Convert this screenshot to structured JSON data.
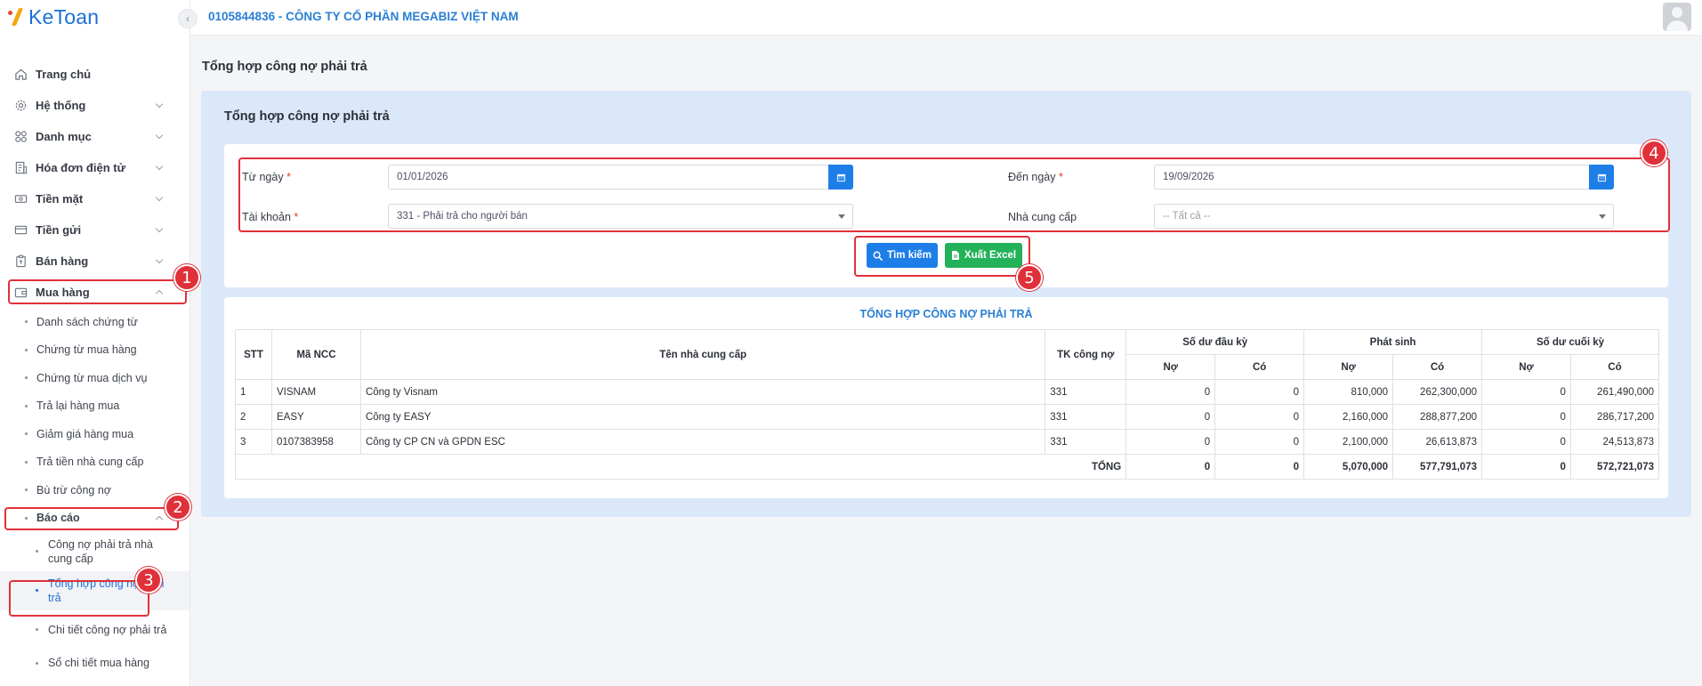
{
  "app": {
    "logo_text": "KeToan"
  },
  "topbar": {
    "company": "0105844836 - CÔNG TY CỔ PHẦN MEGABIZ VIỆT NAM"
  },
  "sidebar": {
    "items": [
      {
        "label": "Trang chủ",
        "icon": "home-icon"
      },
      {
        "label": "Hệ thống",
        "icon": "gear-icon"
      },
      {
        "label": "Danh mục",
        "icon": "grid-icon"
      },
      {
        "label": "Hóa đơn điện tử",
        "icon": "invoice-icon"
      },
      {
        "label": "Tiền mặt",
        "icon": "cash-icon"
      },
      {
        "label": "Tiền gửi",
        "icon": "card-icon"
      },
      {
        "label": "Bán hàng",
        "icon": "clipboard-icon"
      },
      {
        "label": "Mua hàng",
        "icon": "wallet-icon"
      }
    ],
    "purchase_sub": [
      "Danh sách chứng từ",
      "Chứng từ mua hàng",
      "Chứng từ mua dịch vụ",
      "Trả lại hàng mua",
      "Giảm giá hàng mua",
      "Trả tiền nhà cung cấp",
      "Bù trừ công nợ"
    ],
    "reports_label": "Báo cáo",
    "reports_sub": [
      "Công nợ phải trả nhà cung cấp",
      "Tổng hợp công nợ phải trả",
      "Chi tiết công nợ phải trả",
      "Sổ chi tiết mua hàng"
    ]
  },
  "page": {
    "title": "Tổng hợp công nợ phải trả",
    "panel_title": "Tổng hợp công nợ phải trả"
  },
  "filters": {
    "from_label": "Từ ngày",
    "from_value": "01/01/2026",
    "to_label": "Đến ngày",
    "to_value": "19/09/2026",
    "account_label": "Tài khoản",
    "account_value": "331 - Phải trả cho người bán",
    "supplier_label": "Nhà cung cấp",
    "supplier_value": "-- Tất cả --",
    "required_mark": "*",
    "search_label": "Tìm kiếm",
    "excel_label": "Xuất Excel"
  },
  "report": {
    "title": "TỔNG HỢP CÔNG NỢ PHẢI TRẢ",
    "headers": {
      "stt": "STT",
      "code": "Mã NCC",
      "name": "Tên nhà cung cấp",
      "account": "TK công nợ",
      "opening": "Số dư đầu kỳ",
      "movement": "Phát sinh",
      "closing": "Số dư cuối kỳ",
      "debit": "Nợ",
      "credit": "Có"
    },
    "rows": [
      {
        "stt": "1",
        "code": "VISNAM",
        "name": "Công ty Visnam",
        "account": "331",
        "open_debit": "0",
        "open_credit": "0",
        "mv_debit": "810,000",
        "mv_credit": "262,300,000",
        "close_debit": "0",
        "close_credit": "261,490,000"
      },
      {
        "stt": "2",
        "code": "EASY",
        "name": "Công ty EASY",
        "account": "331",
        "open_debit": "0",
        "open_credit": "0",
        "mv_debit": "2,160,000",
        "mv_credit": "288,877,200",
        "close_debit": "0",
        "close_credit": "286,717,200"
      },
      {
        "stt": "3",
        "code": "0107383958",
        "name": "Công ty CP CN và GPDN ESC",
        "account": "331",
        "open_debit": "0",
        "open_credit": "0",
        "mv_debit": "2,100,000",
        "mv_credit": "26,613,873",
        "close_debit": "0",
        "close_credit": "24,513,873"
      }
    ],
    "total": {
      "label": "TỔNG",
      "open_debit": "0",
      "open_credit": "0",
      "mv_debit": "5,070,000",
      "mv_credit": "577,791,073",
      "close_debit": "0",
      "close_credit": "572,721,073"
    }
  },
  "annotations": {
    "b1": "1",
    "b2": "2",
    "b3": "3",
    "b4": "4",
    "b5": "5"
  },
  "colors": {
    "primary": "#1e7ee8",
    "success": "#23b25a",
    "annotation": "#e0313a",
    "panel": "#dbe8fa"
  }
}
